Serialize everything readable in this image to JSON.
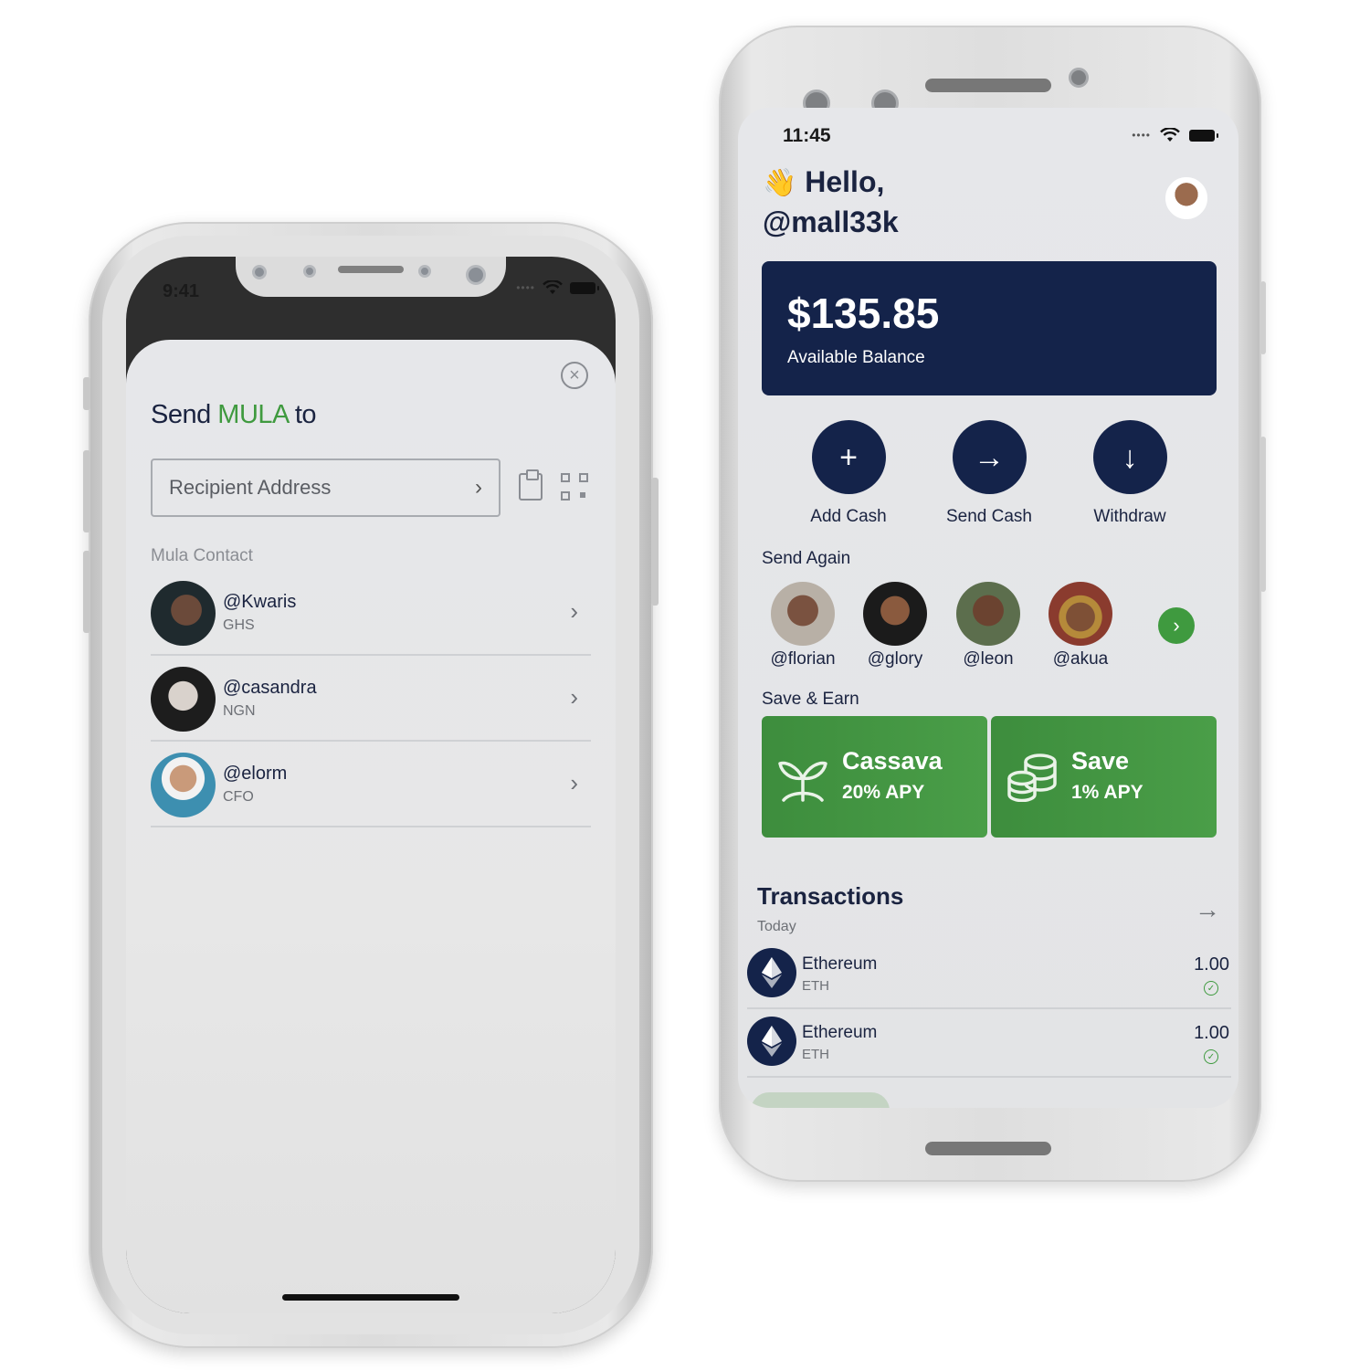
{
  "left_screen": {
    "status": {
      "time": "9:41"
    },
    "title": {
      "prefix": "Send ",
      "brand": "MULA",
      "suffix": " to"
    },
    "recipient": {
      "placeholder": "Recipient Address"
    },
    "contacts_label": "Mula Contact",
    "contacts": [
      {
        "handle": "@Kwaris",
        "currency": "GHS"
      },
      {
        "handle": "@casandra",
        "currency": "NGN"
      },
      {
        "handle": "@elorm",
        "currency": "CFO"
      }
    ],
    "icons": {
      "close": "close-icon",
      "clipboard": "clipboard-icon",
      "qr": "qr-code-icon",
      "chevron": "chevron-right-icon"
    }
  },
  "right_screen": {
    "status": {
      "time": "11:45"
    },
    "greeting": {
      "line1": "Hello,",
      "line2": "@mall33k"
    },
    "balance": {
      "amount": "$135.85",
      "label": "Available Balance"
    },
    "actions": [
      {
        "label": "Add Cash",
        "glyph": "+"
      },
      {
        "label": "Send Cash",
        "glyph": "→"
      },
      {
        "label": "Withdraw",
        "glyph": "↓"
      }
    ],
    "send_again_label": "Send Again",
    "send_again": [
      {
        "handle": "@florian"
      },
      {
        "handle": "@glory"
      },
      {
        "handle": "@leon"
      },
      {
        "handle": "@akua"
      }
    ],
    "save_earn_label": "Save & Earn",
    "earn_cards": [
      {
        "title": "Cassava",
        "rate": "20% APY"
      },
      {
        "title": "Save",
        "rate": "1% APY"
      }
    ],
    "transactions_title": "Transactions",
    "transactions_today": "Today",
    "transactions": [
      {
        "name": "Ethereum",
        "symbol": "ETH",
        "amount": "1.00"
      },
      {
        "name": "Ethereum",
        "symbol": "ETH",
        "amount": "1.00"
      }
    ]
  },
  "colors": {
    "navy": "#14234a",
    "green": "#3f9a3f",
    "muted": "#8a8d93"
  }
}
